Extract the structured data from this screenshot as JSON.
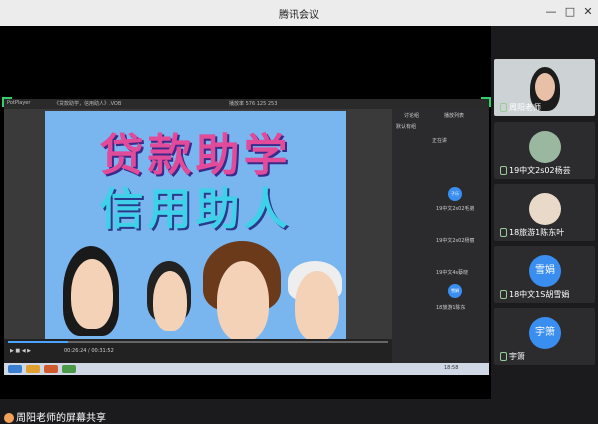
{
  "window": {
    "title": "腾讯会议",
    "minimize": "—",
    "maximize": "□",
    "close": "✕"
  },
  "shared_screen": {
    "player_app": "PotPlayer",
    "file_title": "《贷款助学，信用助人》.VOB",
    "top_info": "播放率 576 125 253",
    "slide_line1": "贷款助学",
    "slide_line2": "信用助人",
    "time_text": "00:26:24 / 00:31:52",
    "chat_tabs": [
      "讨论组",
      "播放列表"
    ],
    "chat_header": "默认有组",
    "chat_items": [
      "正在讲",
      "19中文2s02毛弟",
      "19中文2s02杨丽",
      "19中文4s蔡晓",
      "18旅游1陈东"
    ],
    "mini_avatars": [
      "子乐",
      "雪娟"
    ],
    "clock": "18:58"
  },
  "screen_owner_label": "周阳老师的屏幕共享",
  "participants": [
    {
      "name": "周阳老师",
      "kind": "video"
    },
    {
      "name": "19中文2s02杨芸",
      "kind": "photo"
    },
    {
      "name": "18旅游1陈东叶",
      "kind": "photo"
    },
    {
      "name": "18中文1S胡雪娟",
      "kind": "text",
      "avatar_text": "雪娟"
    },
    {
      "name": "宇箫",
      "kind": "text",
      "avatar_text": "宇箫"
    }
  ]
}
